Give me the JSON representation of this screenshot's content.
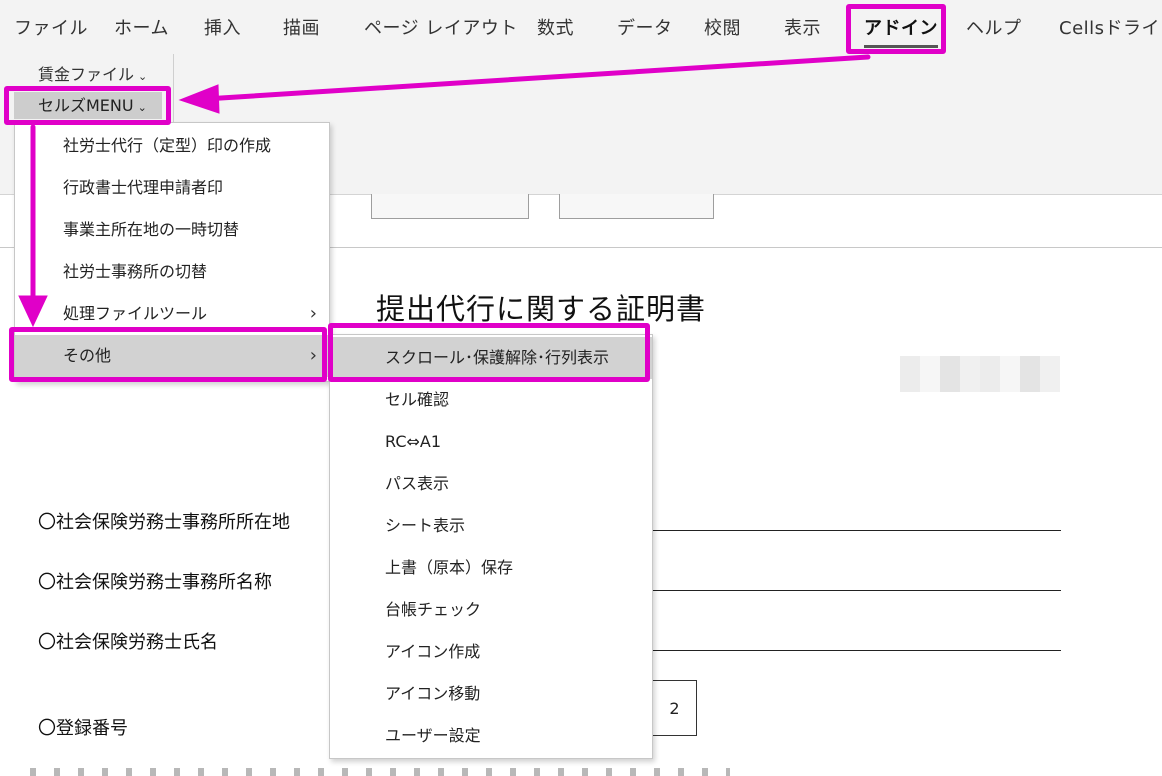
{
  "ribbon": {
    "tabs": [
      "ファイル",
      "ホーム",
      "挿入",
      "描画",
      "ページ レイアウト",
      "数式",
      "データ",
      "校閲",
      "表示",
      "アドイン",
      "ヘルプ",
      "Cellsドライブ"
    ],
    "active_tab": "アドイン",
    "chinkin_file_label": "賃金ファイル",
    "cells_menu_label": "セルズMENU",
    "chevron": "⌄"
  },
  "menu_primary": {
    "items": [
      "社労士代行（定型）印の作成",
      "行政書士代理申請者印",
      "事業主所在地の一時切替",
      "社労士事務所の切替",
      "処理ファイルツール",
      "その他"
    ],
    "submenu_arrow": "›",
    "highlighted": "その他"
  },
  "menu_secondary": {
    "items": [
      "スクロール･保護解除･行列表示",
      "セル確認",
      "RC⇔A1",
      "パス表示",
      "シート表示",
      "上書（原本）保存",
      "台帳チェック",
      "アイコン作成",
      "アイコン移動",
      "ユーザー設定"
    ],
    "highlighted": "スクロール･保護解除･行列表示"
  },
  "document": {
    "title": "提出代行に関する証明書",
    "fields": [
      "〇社会保険労務士事務所所在地",
      "〇社会保険労務士事務所名称",
      "〇社会保険労務士氏名",
      "〇登録番号"
    ],
    "registration_digit": "2"
  },
  "colors": {
    "annotation": "#e000c8",
    "highlight": "#d2d2d2",
    "ribbon_bg": "#f3f3f3"
  }
}
